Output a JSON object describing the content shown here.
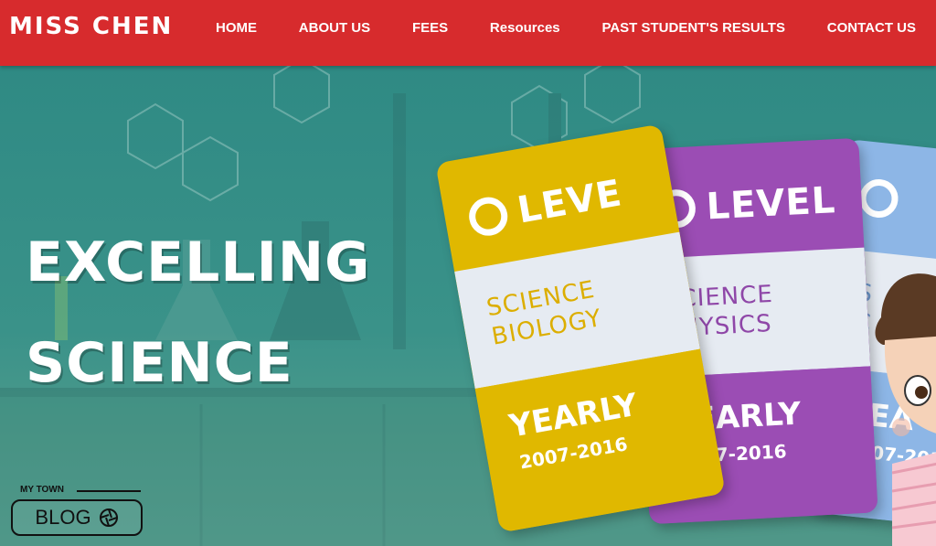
{
  "brand": "MISS CHEN",
  "nav": {
    "items": [
      "HOME",
      "ABOUT US",
      "FEES",
      "Resources",
      "PAST STUDENT'S RESULTS",
      "CONTACT US"
    ]
  },
  "hero": {
    "line1": "EXCELLING",
    "line2": "SCIENCE"
  },
  "cards": [
    {
      "level": "LEVE",
      "subject_line1": "SCIENCE",
      "subject_line2": "BIOLOGY",
      "yearly": "YEARLY",
      "years": "2007-2016",
      "color": "#e0b800",
      "text_color": "#dcae00"
    },
    {
      "level": "LEVEL",
      "subject_line1": "SCIENCE",
      "subject_line2": "PHYSICS",
      "yearly": "YEARLY",
      "years": "2007-2016",
      "color": "#9b4db4",
      "text_color": "#8f47a8"
    },
    {
      "level": "",
      "subject_line1": "S",
      "subject_line2": "C",
      "yearly": "YEA",
      "years": "2007-201",
      "color": "#8db6e6",
      "text_color": "#6f9ad0"
    }
  ],
  "blog_badge": {
    "top_label": "MY TOWN",
    "label": "BLOG"
  },
  "colors": {
    "nav": "#d72b2d",
    "hero": "#3a9289"
  }
}
